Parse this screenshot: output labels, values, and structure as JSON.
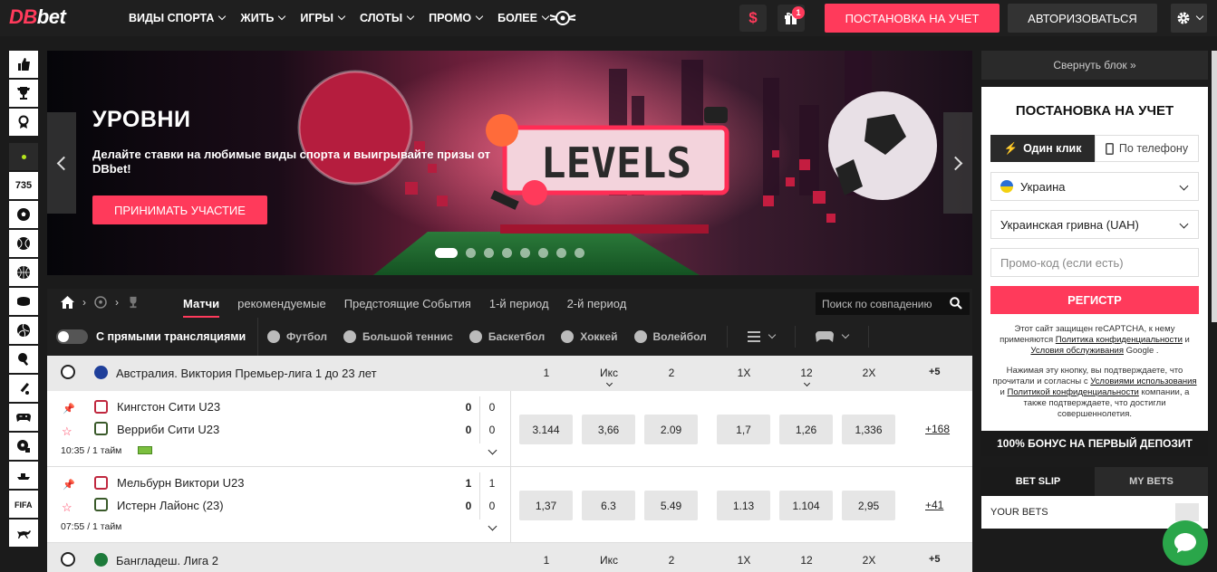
{
  "logo": {
    "part1": "DB",
    "part2": "bet"
  },
  "nav": [
    {
      "label": "ВИДЫ СПОРТА"
    },
    {
      "label": "ЖИТЬ"
    },
    {
      "label": "ИГРЫ"
    },
    {
      "label": "СЛОТЫ"
    },
    {
      "label": "ПРОМО"
    },
    {
      "label": "БОЛЕЕ"
    }
  ],
  "header": {
    "dollar": "$",
    "gift_count": "1",
    "register_label": "ПОСТАНОВКА НА УЧЕТ",
    "login_label": "АВТОРИЗОВАТЬСЯ"
  },
  "sidebar": {
    "live_count": "735"
  },
  "banner": {
    "title": "УРОВНИ",
    "text": "Делайте ставки на любимые виды спорта и выигрывайте призы от DBbet!",
    "button": "ПРИНИМАТЬ УЧАСТИЕ",
    "art_word": "LEVELS",
    "slides": 8,
    "active_slide": 0
  },
  "events": {
    "tabs": [
      "Матчи",
      "рекомендуемые",
      "Предстоящие События",
      "1-й период",
      "2-й период"
    ],
    "active_tab": "Матчи",
    "search_placeholder": "Поиск по совпадению",
    "toggle_label": "С прямыми трансляциями",
    "sport_filters": [
      "Футбол",
      "Большой теннис",
      "Баскетбол",
      "Хоккей",
      "Волейбол"
    ]
  },
  "table": {
    "headers": [
      "1",
      "Икс",
      "2",
      "1X",
      "12",
      "2X"
    ],
    "leagues": [
      {
        "name": "Австралия. Виктория Премьер-лига 1 до 23 лет",
        "more": "+5",
        "flag_color": "#1f3f9a",
        "matches": [
          {
            "team1": "Кингстон Сити U23",
            "team2": "Верриби Сити U23",
            "score1": "0",
            "score2": "0",
            "period1": "0",
            "period2": "0",
            "time": "10:35 / 1 тайм",
            "odds": [
              "3.144",
              "3,66",
              "2.09",
              "1,7",
              "1,26",
              "1,336"
            ],
            "more": "+168"
          },
          {
            "team1": "Мельбурн Виктори U23",
            "team2": "Истерн Лайонс (23)",
            "score1": "1",
            "score2": "0",
            "period1": "1",
            "period2": "0",
            "time": "07:55 / 1 тайм",
            "odds": [
              "1,37",
              "6.3",
              "5.49",
              "1.13",
              "1.104",
              "2,95"
            ],
            "more": "+41"
          }
        ]
      },
      {
        "name": "Бангладеш. Лига 2",
        "more": "+5",
        "flag_color": "#1d7a3a",
        "matches": []
      }
    ]
  },
  "right_panel": {
    "collapse": "Свернуть блок »",
    "reg_title": "ПОСТАНОВКА НА УЧЕТ",
    "tab_one_click": "Один клик",
    "tab_phone": "По телефону",
    "country": "Украина",
    "currency": "Украинская гривна (UAH)",
    "promo_placeholder": "Промо-код (если есть)",
    "submit": "РЕГИСТР",
    "recaptcha_1": "Этот сайт защищен reCAPTCHA, к нему применяются ",
    "privacy_link": "Политика конфиденциальности",
    "recaptcha_2": " и ",
    "terms_link": "Условия обслуживания",
    "recaptcha_3": " Google .",
    "agree_1": "Нажимая эту кнопку, вы подтверждаете, что прочитали и согласны с ",
    "agree_terms": "Условиями использования",
    "agree_2": " и ",
    "agree_privacy": "Политикой конфиденциальности",
    "agree_3": " компании, а также подтверждаете, что достигли совершеннолетия.",
    "bonus": "100% БОНУС НА ПЕРВЫЙ ДЕПОЗИТ",
    "bet_slip": "BET SLIP",
    "my_bets": "MY BETS",
    "your_bets": "YOUR BETS"
  },
  "colors": {
    "accent": "#ff3a5b",
    "chat": "#2aa64a"
  }
}
